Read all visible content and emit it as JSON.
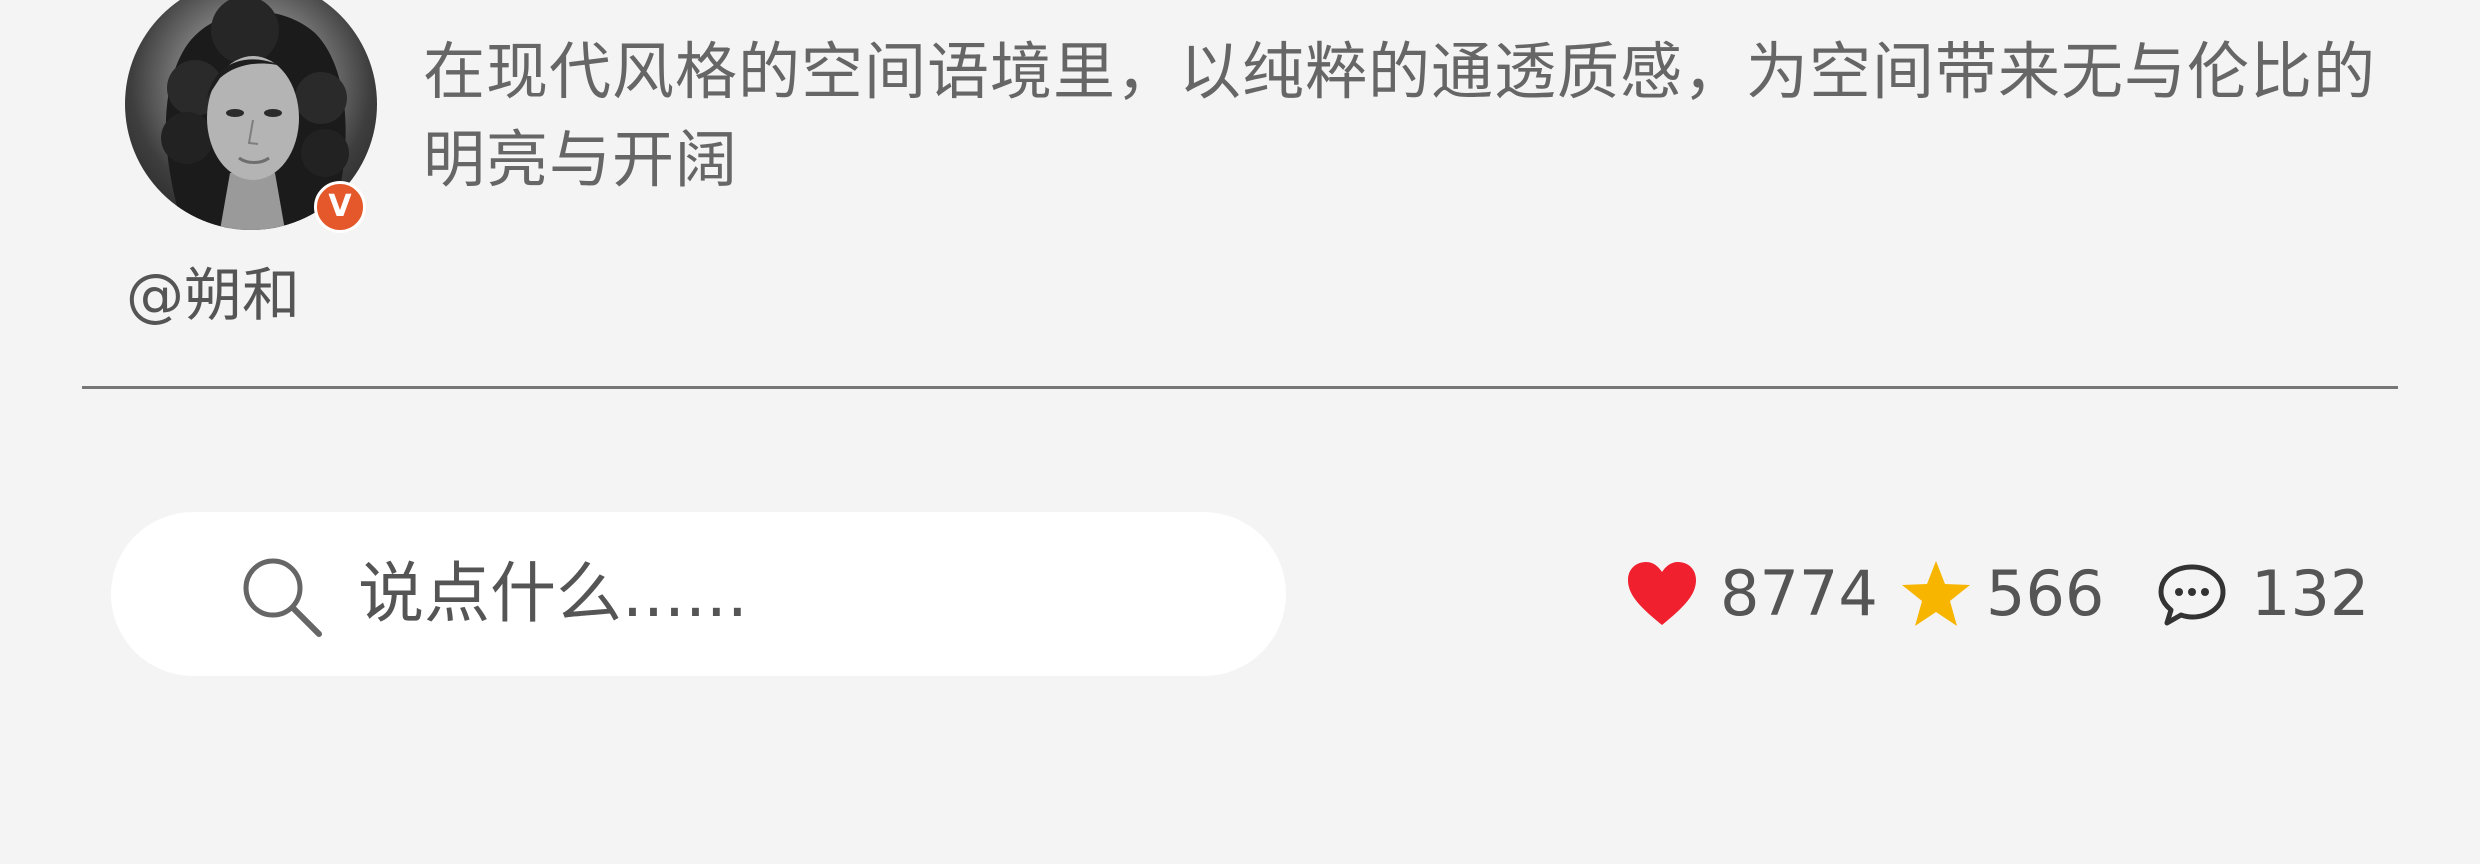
{
  "post": {
    "text": "在现代风格的空间语境里，以纯粹的通透质感，为空间带来无与伦比的明亮与开阔",
    "author": {
      "username": "@朔和",
      "verified_label": "V"
    }
  },
  "actions": {
    "comment_placeholder": "说点什么......",
    "likes": "8774",
    "favorites": "566",
    "comments": "132"
  },
  "icons": {
    "search": "search-icon",
    "like": "heart-icon",
    "favorite": "star-icon",
    "comment": "comment-bubble-icon"
  },
  "colors": {
    "background": "#f4f4f4",
    "like": "#f0202f",
    "favorite": "#f8b500",
    "verified": "#e4582b"
  }
}
